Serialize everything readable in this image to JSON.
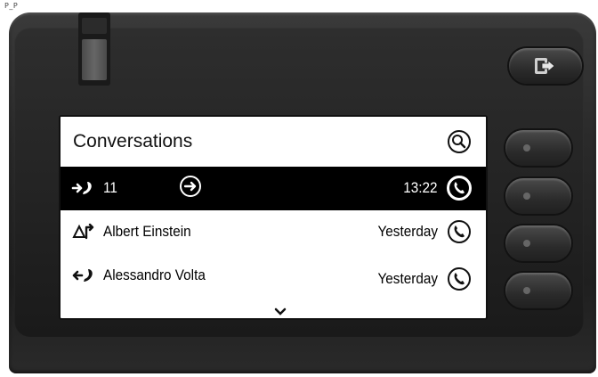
{
  "corner_label": "P_P",
  "screen": {
    "title": "Conversations",
    "rows": [
      {
        "name": "11",
        "time": "13:22",
        "selected": true,
        "type_icon": "outgoing-call-icon",
        "arrow_icon": "arrow-right-circle-icon"
      },
      {
        "name": "Albert Einstein",
        "time": "Yesterday",
        "selected": false,
        "type_icon": "forwarded-call-icon"
      },
      {
        "name": "Alessandro Volta",
        "time": "Yesterday",
        "selected": false,
        "type_icon": "incoming-call-icon"
      }
    ]
  },
  "icons": {
    "search": "search-icon",
    "call": "handset-icon",
    "scroll": "chevron-down-icon",
    "exit": "exit-icon"
  }
}
